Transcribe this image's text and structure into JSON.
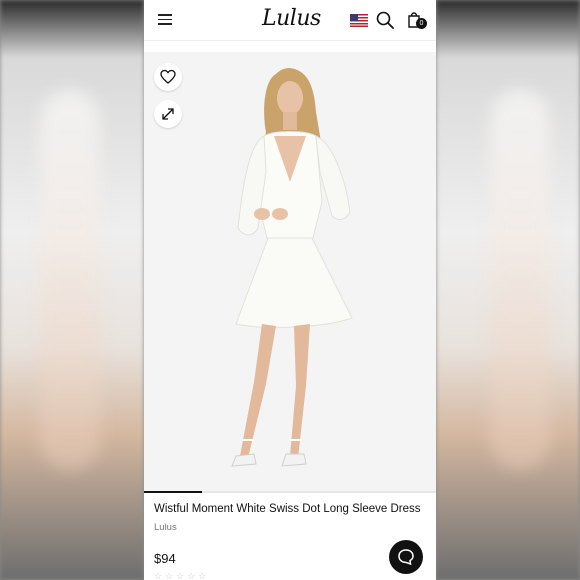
{
  "header": {
    "logo": "Lulus",
    "bag_count": "0",
    "icons": [
      "menu-icon",
      "us-flag-icon",
      "search-icon",
      "shopping-bag-icon"
    ]
  },
  "gallery": {
    "icons": [
      "heart-icon",
      "expand-icon"
    ],
    "image_description": "Model wearing a white swiss dot long sleeve dress with white strappy heels",
    "progress": 0.2
  },
  "product": {
    "title": "Wistful Moment White Swiss Dot Long Sleeve Dress",
    "brand": "Lulus",
    "price": "$94",
    "rating": "☆☆☆☆☆"
  },
  "chat": {
    "icon": "chat-icon"
  },
  "colors": {
    "text": "#111111",
    "muted": "#777777",
    "background": "#ffffff"
  }
}
